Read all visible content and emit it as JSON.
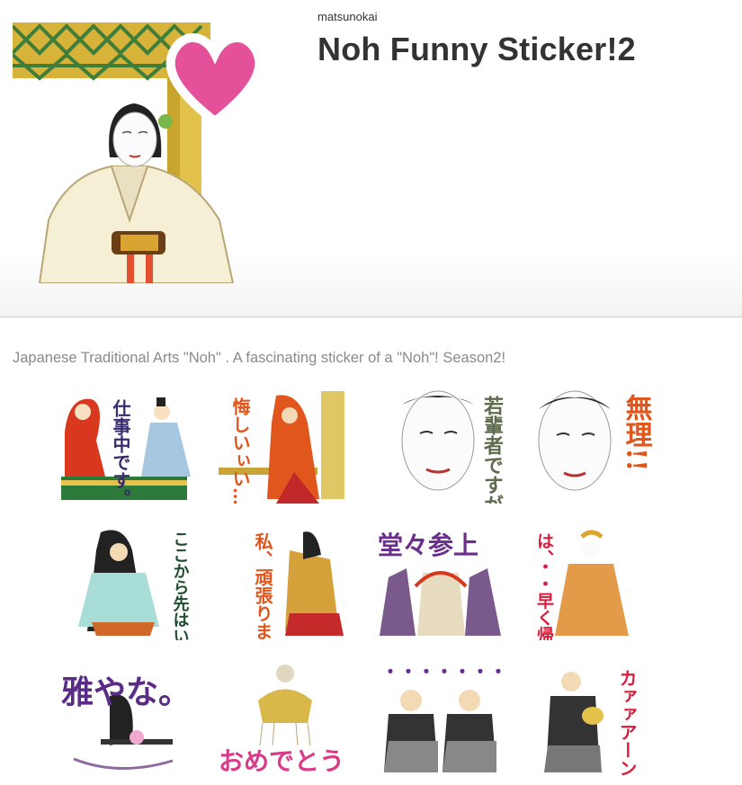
{
  "header": {
    "author": "matsunokai",
    "title": "Noh Funny Sticker!2"
  },
  "description": "Japanese Traditional Arts \"Noh\" . A fascinating sticker of a \"Noh\"! Season2!",
  "stickers": [
    {
      "text": "仕事中です。",
      "color": "#3a2a6e"
    },
    {
      "text": "悔しいぃい…!!",
      "color": "#e0561d"
    },
    {
      "text": "若輩者ですが・・",
      "color": "#5f6b4f"
    },
    {
      "text": "無理!!",
      "color": "#e0561d"
    },
    {
      "text": "ここから先はいってはなりませぬ!",
      "color": "#1f4d2e"
    },
    {
      "text": "私、頑張りまする!",
      "color": "#e0561d"
    },
    {
      "text": "堂々参上",
      "color": "#6a2f8a"
    },
    {
      "text": "は、・・早く帰りたい!!",
      "color": "#d91e3c"
    },
    {
      "text": "雅やな。",
      "color": "#5a2c86"
    },
    {
      "text": "おめでとう",
      "color": "#d93a8a"
    },
    {
      "text": "・・・・・・・・。",
      "color": "#6a2f8a"
    },
    {
      "text": "カァァアーン",
      "color": "#d91e3c"
    }
  ]
}
